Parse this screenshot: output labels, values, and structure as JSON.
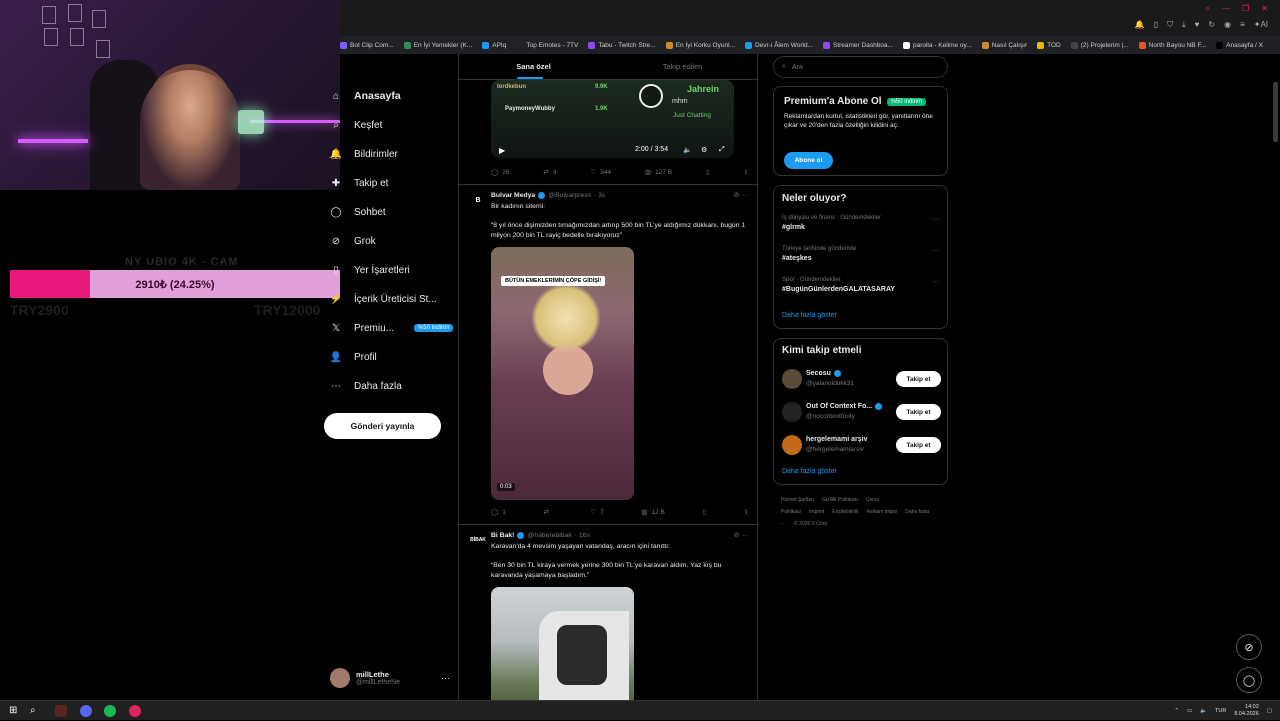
{
  "browser": {
    "bookmarks": [
      {
        "label": "Bot Clip Com...",
        "color": "#7a5cff"
      },
      {
        "label": "En İyi Yemekler (K...",
        "color": "#2e8b57"
      },
      {
        "label": "APIq",
        "color": "#1d9bf0"
      },
      {
        "label": "Top Emotes - 7TV",
        "color": "#222"
      },
      {
        "label": "Tabu - Twitch Stre...",
        "color": "#9146ff"
      },
      {
        "label": "En İyi Korku Oyunl...",
        "color": "#d08a2c"
      },
      {
        "label": "Devr-i Âlem World...",
        "color": "#1d9bf0"
      },
      {
        "label": "Streamer Dashboa...",
        "color": "#9146ff"
      },
      {
        "label": "parolla - Kelime oy...",
        "color": "#ffffff"
      },
      {
        "label": "Nasıl Çalışır",
        "color": "#d08a2c"
      },
      {
        "label": "TOD",
        "color": "#e8b90c"
      },
      {
        "label": "(2) Projelerim |...",
        "color": "#444"
      },
      {
        "label": "North Bayou NB F...",
        "color": "#e8541d"
      },
      {
        "label": "Anasayfa / X",
        "color": "#000"
      }
    ],
    "icons": [
      "bell-icon",
      "bookmark-icon",
      "shield-icon",
      "download-icon",
      "heart-icon",
      "refresh-icon",
      "avatar-icon",
      "menu-icon",
      "ai-icon"
    ],
    "ai_label": "AI"
  },
  "donation_goal": {
    "ghost_text": "NY UBIO 4K - CAM",
    "label": "2910₺ (24.25%)",
    "progress_fraction": 0.2425,
    "start": "TRY2900",
    "end": "TRY12000",
    "fill_color": "#e8197a",
    "track_color": "#e39fd9"
  },
  "sidebar": {
    "items": [
      {
        "label": "Anasayfa",
        "icon": "home-icon",
        "glyph": "⌂",
        "active": true
      },
      {
        "label": "Keşfet",
        "icon": "search-icon",
        "glyph": "⌕",
        "active": false
      },
      {
        "label": "Bildirimler",
        "icon": "bell-icon",
        "glyph": "🔔",
        "active": false
      },
      {
        "label": "Takip et",
        "icon": "follow-icon",
        "glyph": "✚",
        "active": false
      },
      {
        "label": "Sohbet",
        "icon": "chat-icon",
        "glyph": "◯",
        "active": false
      },
      {
        "label": "Grok",
        "icon": "grok-icon",
        "glyph": "⊘",
        "active": false
      },
      {
        "label": "Yer İşaretleri",
        "icon": "bookmark-icon",
        "glyph": "▯",
        "active": false
      },
      {
        "label": "İçerik Üreticisi St...",
        "icon": "creator-icon",
        "glyph": "⚡",
        "active": false
      },
      {
        "label": "Premiu...",
        "icon": "x-logo-icon",
        "glyph": "𝕏",
        "active": false,
        "badge": "%50 indirim"
      },
      {
        "label": "Profil",
        "icon": "profile-icon",
        "glyph": "👤",
        "active": false
      },
      {
        "label": "Daha fazla",
        "icon": "more-icon",
        "glyph": "⋯",
        "active": false
      }
    ],
    "post_button": "Gönderi yayınla",
    "account": {
      "name": "millLethe",
      "handle": "@millLetheNe"
    }
  },
  "feed": {
    "tabs": [
      {
        "label": "Sana özel",
        "active": true
      },
      {
        "label": "Takip edilen",
        "active": false
      }
    ],
    "video_overlay": {
      "chat_name_1": "lordkebun",
      "chat_count_1": "9.9K",
      "chat_name_2": "PaymoneyWubby",
      "chat_count_2": "1.9K",
      "streamer": "Jahrein",
      "streamer_sub": "mhm",
      "category": "Just Chatting",
      "time": "2:00 / 3:54"
    },
    "tweet0_actions": {
      "replies": "26",
      "retweets": "3",
      "likes": "344",
      "views": "127 B"
    },
    "tweets": [
      {
        "name": "Bulvar Medya",
        "handle": "@Bulvarpress",
        "time": "· 3s",
        "avatar_color": "#d0021b",
        "avatar_text": "B",
        "text1": "Bir kadının sitemi:",
        "text2": "“8 yıl önce dişimizden tırnağımızdan artırıp 500 bin TL’ye aldığımız dükkanı, bugün 1 milyon 200 bin TL rayiç bedelle bırakıyoruz”",
        "media_caption": "BÜTÜN EMEKLERİMİN ÇÖPE GİDİŞİ!",
        "media_duration": "0:03",
        "actions": {
          "replies": "1",
          "retweets": "",
          "likes": "7",
          "views": "12 B"
        }
      },
      {
        "name": "Bi Bak!",
        "handle": "@haberebibak",
        "time": "· 16s",
        "avatar_color": "#e0245e",
        "avatar_text": "BİBAK",
        "text1": "Karavan'da 4 mevsim yaşayan vatandaş, aracın içini tanıttı:",
        "text2": "“Ben 30 bin TL kiraya vermek yerine 300 bin TL’ye karavan aldım. Yaz kış bu karavanda yaşamaya başladım.”"
      }
    ]
  },
  "right": {
    "search_placeholder": "Ara",
    "premium": {
      "title": "Premium'a Abone Ol",
      "badge": "%50 indirim",
      "text": "Reklamlardan kurtul, istatistikleri gör, yanıtlarını öne çıkar ve 20'den fazla özelliğin kilidini aç.",
      "button": "Abone ol"
    },
    "trends": {
      "title": "Neler oluyor?",
      "items": [
        {
          "context": "İş dünyası ve finans · Gündemdekiler",
          "tag": "#glrmk"
        },
        {
          "context": "Türkiye tarihinde gündemde",
          "tag": "#ateşkes"
        },
        {
          "context": "Spor · Gündemdekiler",
          "tag": "#BugünGünlerdenGALATASARAY"
        }
      ],
      "more": "Daha fazla göster"
    },
    "who_to_follow": {
      "title": "Kimi takip etmeli",
      "items": [
        {
          "name": "Secosu",
          "handle": "@yalanoldukk31",
          "verified": true,
          "avatar_color": "#5a4a3a"
        },
        {
          "name": "Out Of Context Fo...",
          "handle": "@nocontextfooty",
          "verified": true,
          "avatar_color": "#222"
        },
        {
          "name": "hergelemami arşiv",
          "handle": "@hergelemamiarsiv",
          "verified": false,
          "avatar_color": "#c06a1a"
        }
      ],
      "follow_label": "Takip et",
      "more": "Daha fazla göster"
    },
    "footer": [
      "Hizmet Şartları",
      "Gizlilik Politikası",
      "Çerez Politikası",
      "Imprint",
      "Erişilebilirlik",
      "Reklam bilgisi",
      "Daha fazla ···",
      "© 2026 X Corp."
    ]
  },
  "taskbar": {
    "lang": "TUR",
    "time": "14:02",
    "date": "8.04.2026"
  }
}
